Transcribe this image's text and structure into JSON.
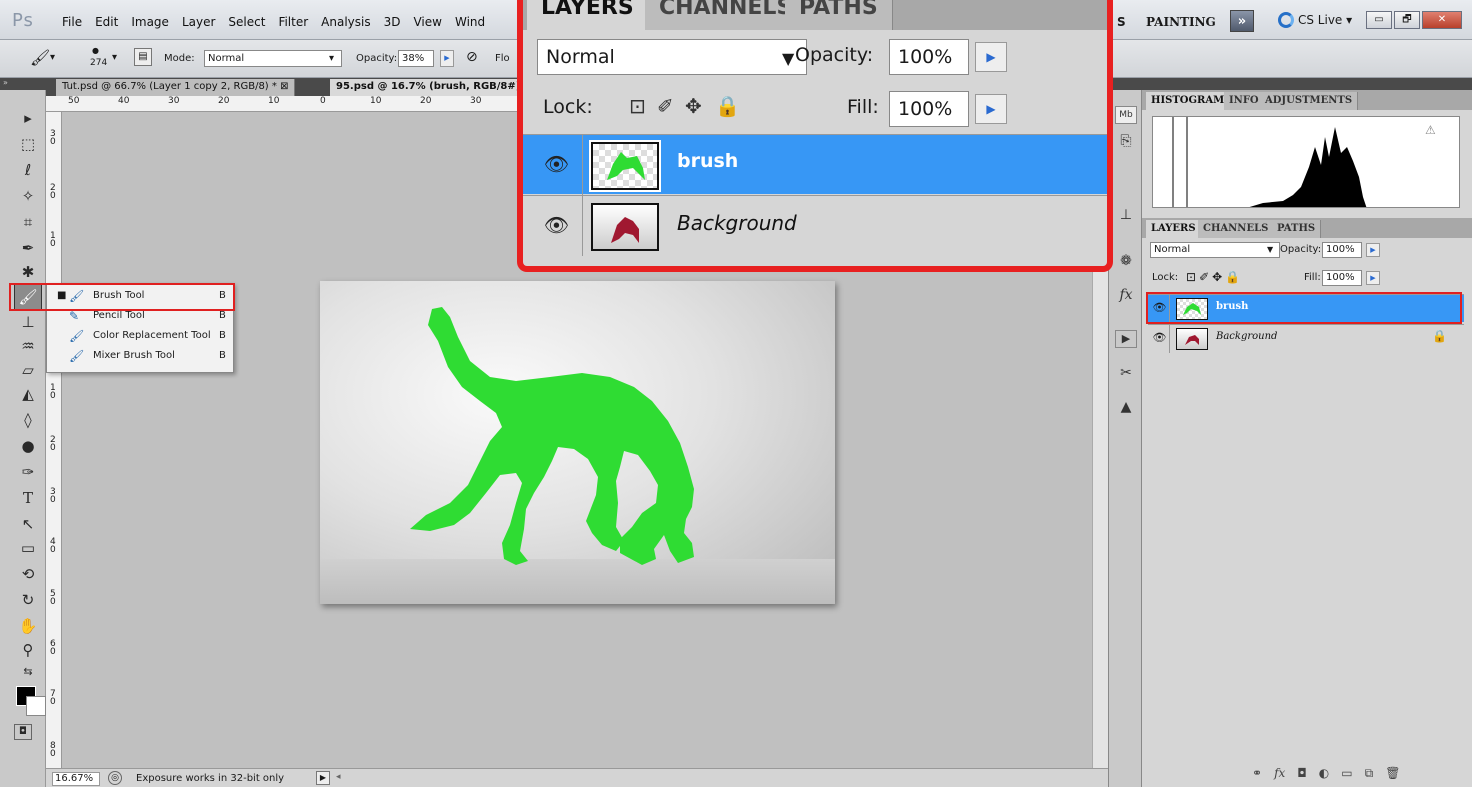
{
  "app": {
    "logo": "Ps"
  },
  "menu": [
    "File",
    "Edit",
    "Image",
    "Layer",
    "Select",
    "Filter",
    "Analysis",
    "3D",
    "View",
    "Wind"
  ],
  "workspace": {
    "s_label": "S",
    "painting": "PAINTING",
    "more": "»",
    "cslive": "CS Live ▾"
  },
  "window_buttons": {
    "minimize": "▭",
    "restore": "🗗",
    "close": "✕"
  },
  "options": {
    "brush_size": "274",
    "mode_label": "Mode:",
    "mode_value": "Normal",
    "opacity_label": "Opacity:",
    "opacity_value": "38%",
    "flow_label": "Flo"
  },
  "doc_tabs": [
    "Tut.psd @ 66.7% (Layer 1 copy 2, RGB/8) * ⊠",
    "95.psd @ 16.7% (brush, RGB/8#)"
  ],
  "ruler_top": [
    "50",
    "40",
    "30",
    "20",
    "10",
    "0",
    "10",
    "20",
    "30"
  ],
  "ruler_left": [
    "3 0",
    "2 0",
    "1 0",
    "0",
    "1 0",
    "2 0",
    "3 0",
    "4 0",
    "5 0",
    "6 0",
    "7 0",
    "8 0",
    "9 0"
  ],
  "flyout": [
    {
      "label": "Brush Tool",
      "key": "B",
      "icon": "🖌",
      "active": true
    },
    {
      "label": "Pencil Tool",
      "key": "B",
      "icon": "✎"
    },
    {
      "label": "Color Replacement Tool",
      "key": "B",
      "icon": "🖌"
    },
    {
      "label": "Mixer Brush Tool",
      "key": "B",
      "icon": "🖌"
    }
  ],
  "zoom_panel": {
    "tabs": [
      "LAYERS",
      "CHANNELS",
      "PATHS"
    ],
    "blend_mode": "Normal",
    "opacity_label": "Opacity:",
    "opacity_value": "100%",
    "lock_label": "Lock:",
    "fill_label": "Fill:",
    "fill_value": "100%",
    "layers": [
      "brush",
      "Background"
    ]
  },
  "right_panel": {
    "histo_tabs": [
      "HISTOGRAM",
      "INFO",
      "ADJUSTMENTS"
    ],
    "layers_tabs": [
      "LAYERS",
      "CHANNELS",
      "PATHS"
    ],
    "blend_mode": "Normal",
    "opacity_label": "Opacity:",
    "opacity_value": "100%",
    "lock_label": "Lock:",
    "fill_label": "Fill:",
    "fill_value": "100%",
    "layers": [
      "brush",
      "Background"
    ],
    "bottom_icons": [
      "⚭",
      "fx",
      "◘",
      "◐",
      "▭",
      "⧉",
      "🗑"
    ]
  },
  "status": {
    "zoom": "16.67%",
    "text": "Exposure works in 32-bit only",
    "arrow": "▶",
    "left": "◂"
  },
  "colors": {
    "selection": "#3797f5",
    "highlight": "#e02020",
    "silhouette": "#2fdc33"
  }
}
